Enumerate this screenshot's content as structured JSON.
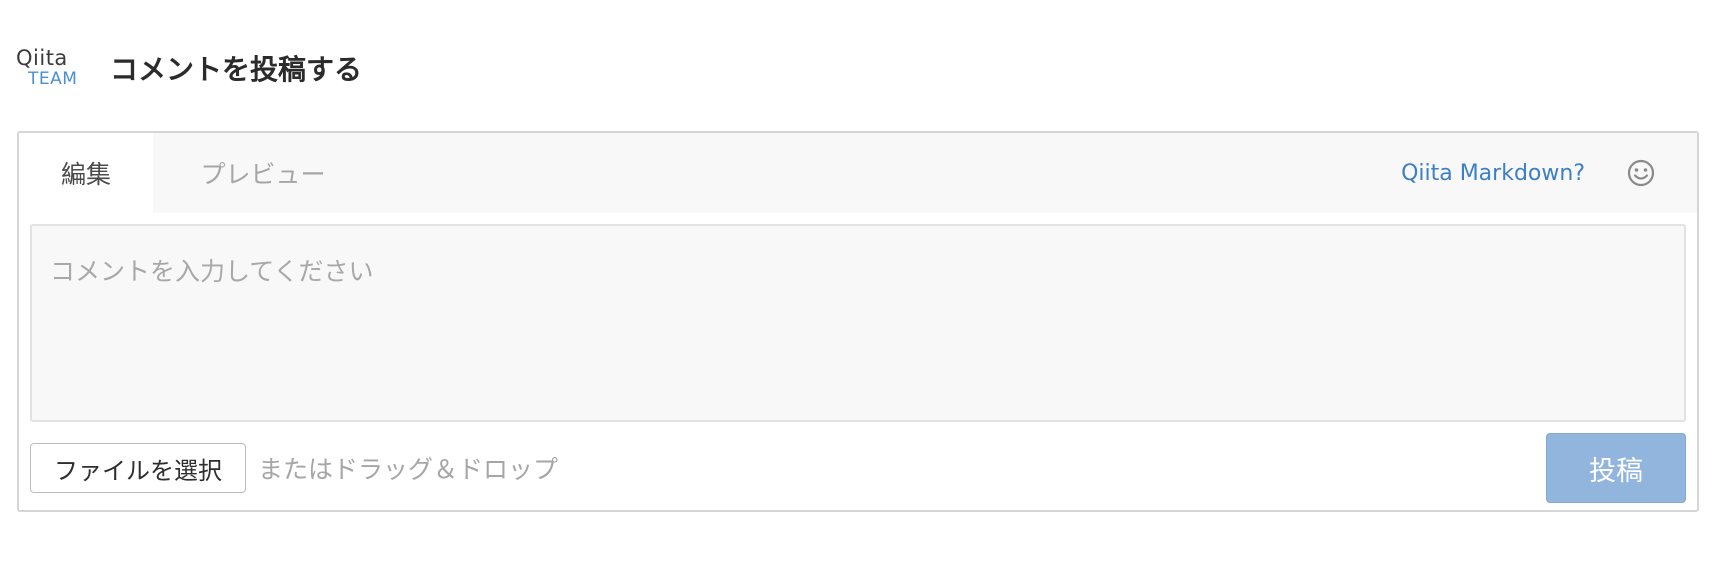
{
  "header": {
    "logo_top": "Qiita",
    "logo_bottom": "TEAM",
    "title": "コメントを投稿する"
  },
  "editor": {
    "tabs": [
      {
        "label": "編集",
        "active": true
      },
      {
        "label": "プレビュー",
        "active": false
      }
    ],
    "markdown_link": "Qiita Markdown?",
    "emoji_icon": "smiley-face-icon",
    "comment": {
      "value": "",
      "placeholder": "コメントを入力してください"
    },
    "file_button": "ファイルを選択",
    "drop_hint": "またはドラッグ＆ドロップ",
    "submit_label": "投稿"
  },
  "colors": {
    "link": "#3d7fc4",
    "logo_team": "#4a8fd4",
    "submit_bg": "#91b5dc"
  }
}
